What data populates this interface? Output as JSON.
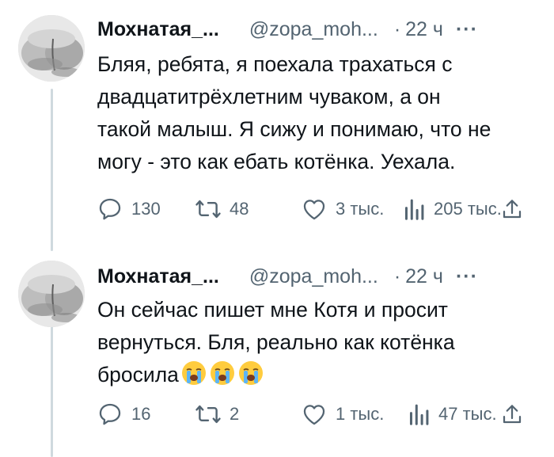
{
  "tweets": [
    {
      "author_name": "Мохнатая_...",
      "handle": "@zopa_moh...",
      "separator": "·",
      "time": "22 ч",
      "more_label": "···",
      "lines": [
        "Бляя, ребята, я поехала трахаться с",
        "двадцатитрёхлетним чуваком, а  он",
        "такой малыш. Я сижу и понимаю, что не",
        "могу - это как ебать котёнка. Уехала."
      ],
      "replies": "130",
      "retweets": "48",
      "likes": "3 тыс.",
      "views": "205 тыс."
    },
    {
      "author_name": "Мохнатая_...",
      "handle": "@zopa_moh...",
      "separator": "·",
      "time": "22 ч",
      "more_label": "···",
      "lines": [
        "Он сейчас пишет мне Котя и просит",
        "вернуться. Бля, реально как котёнка",
        "бросила"
      ],
      "emoji": [
        "loudly-crying-face",
        "loudly-crying-face",
        "loudly-crying-face"
      ],
      "replies": "16",
      "retweets": "2",
      "likes": "1 тыс.",
      "views": "47 тыс."
    }
  ],
  "icons": {
    "reply": "reply-icon",
    "retweet": "retweet-icon",
    "like": "heart-icon",
    "views": "views-chart-icon",
    "share": "share-icon"
  },
  "colors": {
    "text": "#0f1419",
    "secondary": "#536471",
    "thread_line": "#cfd9de"
  }
}
